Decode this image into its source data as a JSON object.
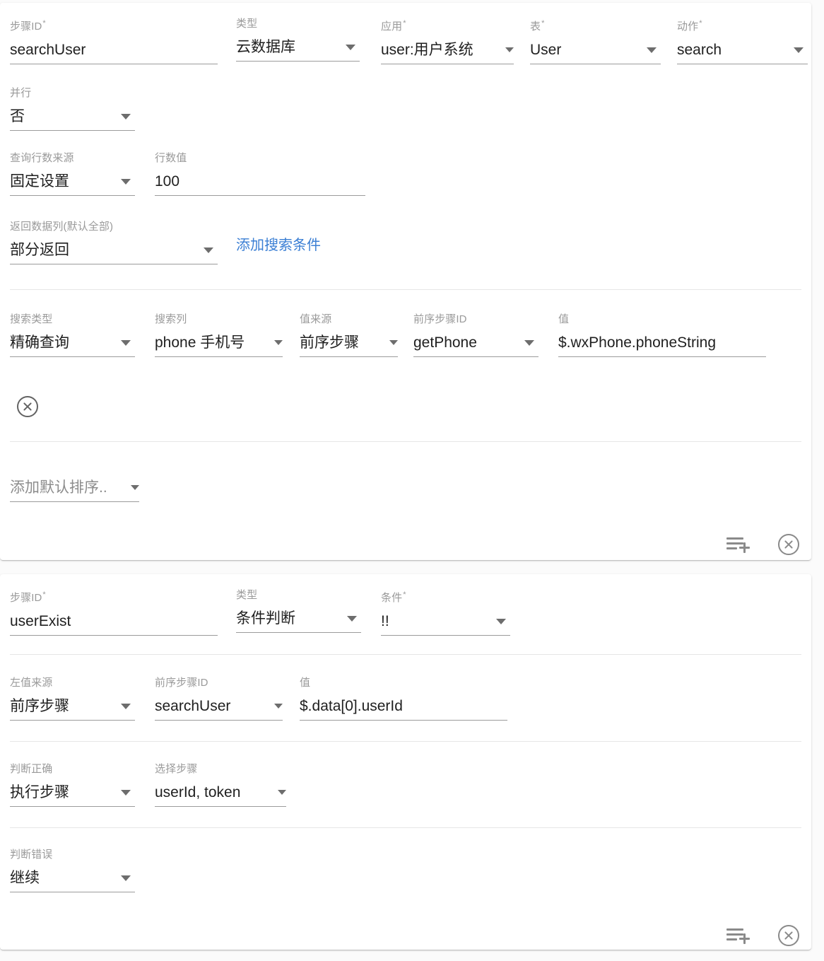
{
  "theme": {
    "card_bg": "#ffffff",
    "page_bg": "#fbfbfb",
    "label_color": "#9a9a9a",
    "value_color": "#1f1f1f",
    "underline_color": "#9b9b9b",
    "divider_color": "#e6e6e6",
    "link_color": "#3b7fd4",
    "icon_color": "#8a8a8a"
  },
  "steps": [
    {
      "header": {
        "step_id": {
          "label": "步骤ID",
          "required": "*",
          "value": "searchUser"
        },
        "type": {
          "label": "类型",
          "required": "",
          "value": "云数据库"
        },
        "app": {
          "label": "应用",
          "required": "*",
          "value": "user:用户系统"
        },
        "table": {
          "label": "表",
          "required": "*",
          "value": "User"
        },
        "action": {
          "label": "动作",
          "required": "*",
          "value": "search"
        }
      },
      "parallel": {
        "label": "并行",
        "value": "否"
      },
      "rows_source": {
        "label": "查询行数来源",
        "value": "固定设置"
      },
      "rows_value": {
        "label": "行数值",
        "value": "100"
      },
      "return_cols": {
        "label": "返回数据列(默认全部)",
        "value": "部分返回"
      },
      "add_condition_link": "添加搜索条件",
      "conditions": [
        {
          "search_type": {
            "label": "搜索类型",
            "value": "精确查询"
          },
          "search_column": {
            "label": "搜索列",
            "value": "phone 手机号"
          },
          "value_source": {
            "label": "值来源",
            "value": "前序步骤"
          },
          "prev_step_id": {
            "label": "前序步骤ID",
            "value": "getPhone"
          },
          "value": {
            "label": "值",
            "value": "$.wxPhone.phoneString"
          },
          "remove_icon": "circle-close-icon"
        }
      ],
      "default_sort": {
        "placeholder": "添加默认排序.."
      },
      "footer": {
        "add_icon": "playlist-add-icon",
        "remove_icon": "circle-close-icon"
      }
    },
    {
      "header": {
        "step_id": {
          "label": "步骤ID",
          "required": "*",
          "value": "userExist"
        },
        "type": {
          "label": "类型",
          "required": "",
          "value": "条件判断"
        },
        "condition": {
          "label": "条件",
          "required": "*",
          "value": "!!"
        }
      },
      "left_value_source": {
        "label": "左值来源",
        "value": "前序步骤"
      },
      "prev_step_id": {
        "label": "前序步骤ID",
        "value": "searchUser"
      },
      "value": {
        "label": "值",
        "value": "$.data[0].userId"
      },
      "on_true": {
        "label": "判断正确",
        "value": "执行步骤"
      },
      "select_steps": {
        "label": "选择步骤",
        "value": "userId, token"
      },
      "on_false": {
        "label": "判断错误",
        "value": "继续"
      },
      "footer": {
        "add_icon": "playlist-add-icon",
        "remove_icon": "circle-close-icon"
      }
    }
  ]
}
